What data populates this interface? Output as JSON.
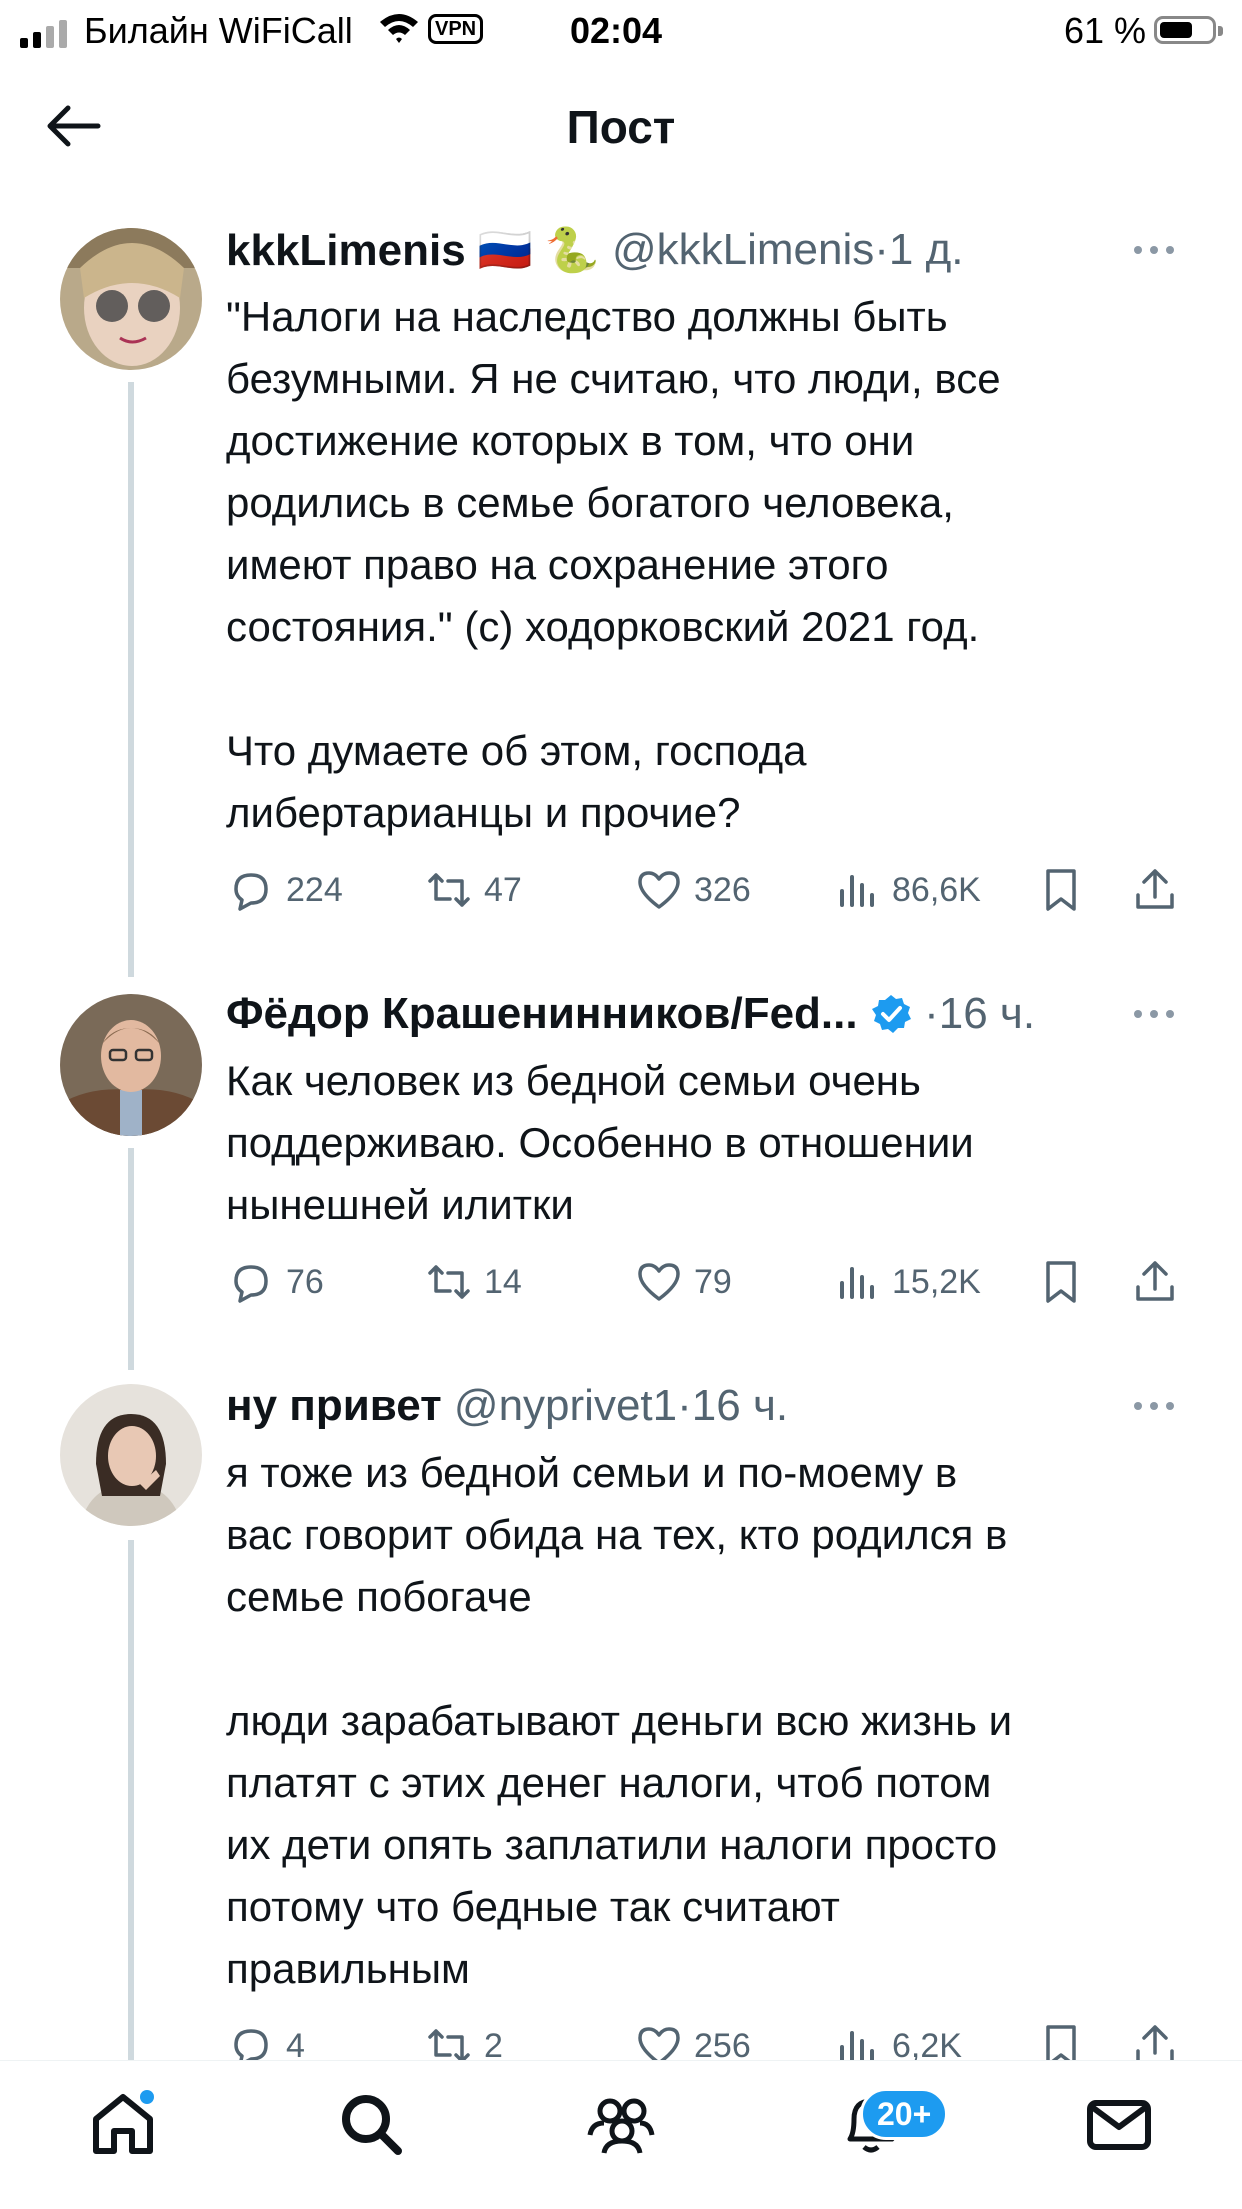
{
  "status_bar": {
    "carrier": "Билайн WiFiCall",
    "vpn": "VPN",
    "time": "02:04",
    "battery": "61 %"
  },
  "header": {
    "title": "Пост"
  },
  "posts": [
    {
      "name": "kkkLimenis 🇷🇺 🐍",
      "handle": "@kkkLimenis",
      "dot": "·",
      "ago": "1 д.",
      "text": "\"Налоги на наследство должны быть\nбезумными. Я не считаю, что люди, все\nдостижение которых в том, что они\nродились в семье богатого человека,\nимеют право на сохранение этого\nсостояния.\" (с) ходорковский 2021 год.\n\nЧто думаете об этом, господа\nлибертарианцы и прочие?",
      "replies": "224",
      "reposts": "47",
      "likes": "326",
      "views": "86,6K"
    },
    {
      "name": "Фёдор Крашенинников/Fed...",
      "verified": true,
      "dot": "·",
      "ago": "16 ч.",
      "text": "Как человек из бедной семьи очень\nподдерживаю. Особенно в отношении\nнынешней илитки",
      "replies": "76",
      "reposts": "14",
      "likes": "79",
      "views": "15,2K"
    },
    {
      "name": "ну привет",
      "handle": "@nyprivet1",
      "dot": "·",
      "ago": "16 ч.",
      "text": "я тоже из бедной семьи и по-моему в\nвас говорит обида на тех, кто родился в\nсемье побогаче\n\nлюди зарабатывают деньги всю жизнь и\nплатят с этих денег налоги, чтоб потом\nих дети опять заплатили налоги просто\nпотому что бедные так считают\nправильным",
      "replies": "4",
      "reposts": "2",
      "likes": "256",
      "views": "6,2K"
    }
  ],
  "tabbar": {
    "notifications_badge": "20+"
  },
  "colors": {
    "accent": "#1d9bf0",
    "secondary_text": "#536471",
    "thread_line": "#cfd9de"
  },
  "icons": [
    "back-arrow-icon",
    "more-icon",
    "reply-icon",
    "repost-icon",
    "like-icon",
    "views-icon",
    "bookmark-icon",
    "share-icon",
    "verified-badge-icon",
    "home-icon",
    "search-icon",
    "communities-icon",
    "notifications-icon",
    "messages-icon"
  ]
}
